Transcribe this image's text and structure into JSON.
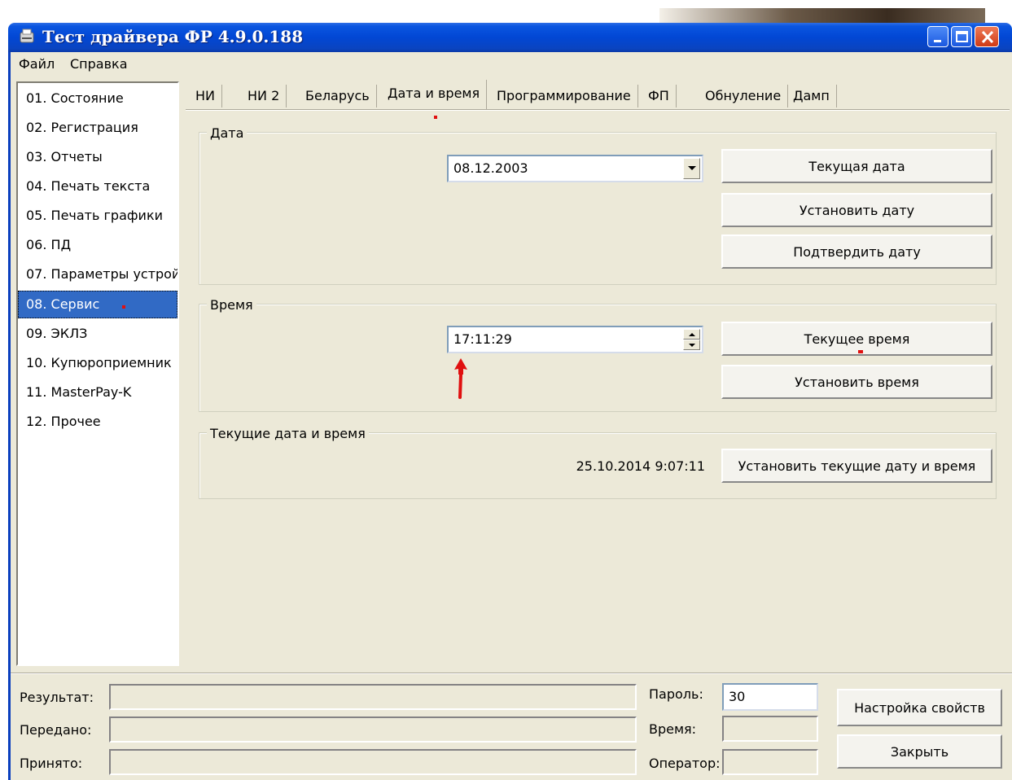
{
  "window": {
    "title": "Тест драйвера ФР 4.9.0.188"
  },
  "menu": [
    "Файл",
    "Справка"
  ],
  "sidebar": {
    "items": [
      "01. Состояние",
      "02. Регистрация",
      "03. Отчеты",
      "04. Печать текста",
      "05. Печать графики",
      "06. ПД",
      "07. Параметры устрой",
      "08. Сервис",
      "09. ЭКЛЗ",
      "10. Купюроприемник",
      "11. MasterPay-K",
      "12. Прочее"
    ],
    "selected": "08. Сервис"
  },
  "tabs": [
    "НИ",
    "НИ 2",
    "Беларусь",
    "Дата и время",
    "Программирование",
    "ФП",
    "Обнуление",
    "Дамп"
  ],
  "active_tab": "Дата и время",
  "date_group": {
    "title": "Дата",
    "date_value": "08.12.2003",
    "buttons": [
      "Текущая дата",
      "Установить дату",
      "Подтвердить дату"
    ]
  },
  "time_group": {
    "title": "Время",
    "time_value": "17:11:29",
    "buttons": [
      "Текущее время",
      "Установить время"
    ]
  },
  "current_group": {
    "title": "Текущие дата и время",
    "value": "25.10.2014  9:07:11",
    "button": "Установить текущие дату и время"
  },
  "bottom": {
    "labels": {
      "result": "Результат:",
      "sent": "Передано:",
      "received": "Принято:",
      "password": "Пароль:",
      "time": "Время:",
      "operator": "Оператор:"
    },
    "values": {
      "result": "",
      "sent": "",
      "received": "",
      "password": "30",
      "time": "",
      "operator": ""
    },
    "buttons": {
      "settings": "Настройка свойств",
      "close": "Закрыть"
    }
  },
  "colors": {
    "titlebar": "#0247d4",
    "selection": "#316ac5",
    "annotation": "#e01010",
    "window_bg": "#ece9d8"
  }
}
